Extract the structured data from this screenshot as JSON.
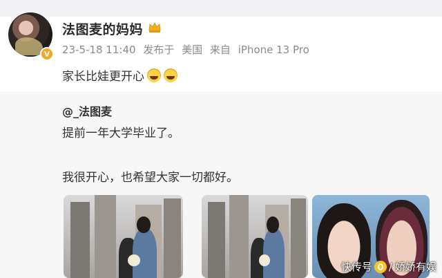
{
  "post": {
    "author": "法图麦的妈妈",
    "date": "23-5-18 11:40",
    "published_from_label": "发布于",
    "location": "美国",
    "device_label": "来自",
    "device": "iPhone 13 Pro",
    "text": "家长比娃更开心",
    "emoji": [
      "laugh-emoji",
      "laugh-emoji"
    ]
  },
  "repost": {
    "author": "@_法图麦",
    "line1": "提前一年大学毕业了。",
    "line2": "我很开心，也希望大家一切都好。"
  },
  "watermark": {
    "text_left": "快传号",
    "separator": "/",
    "text_right": "娇娇有娱"
  },
  "colors": {
    "badge": "#f5a623",
    "text": "#333333",
    "meta": "#8a8a8a"
  }
}
